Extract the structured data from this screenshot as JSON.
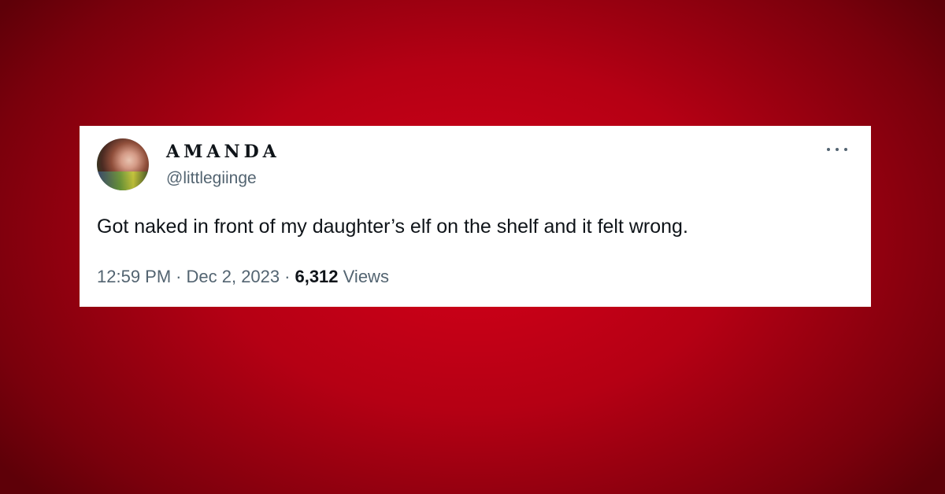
{
  "tweet": {
    "display_name": "AMANDA",
    "handle": "@littlegiinge",
    "text": "Got naked in front of my daughter’s elf on the shelf and it felt wrong.",
    "time": "12:59 PM",
    "separator": "·",
    "date": "Dec 2, 2023",
    "views_count": "6,312",
    "views_label": "Views",
    "more_icon": "more-horizontal-icon",
    "avatar_icon": "profile-photo"
  },
  "colors": {
    "background": "#c8001a",
    "card": "#ffffff",
    "text_primary": "#0f1419",
    "text_secondary": "#536471"
  }
}
